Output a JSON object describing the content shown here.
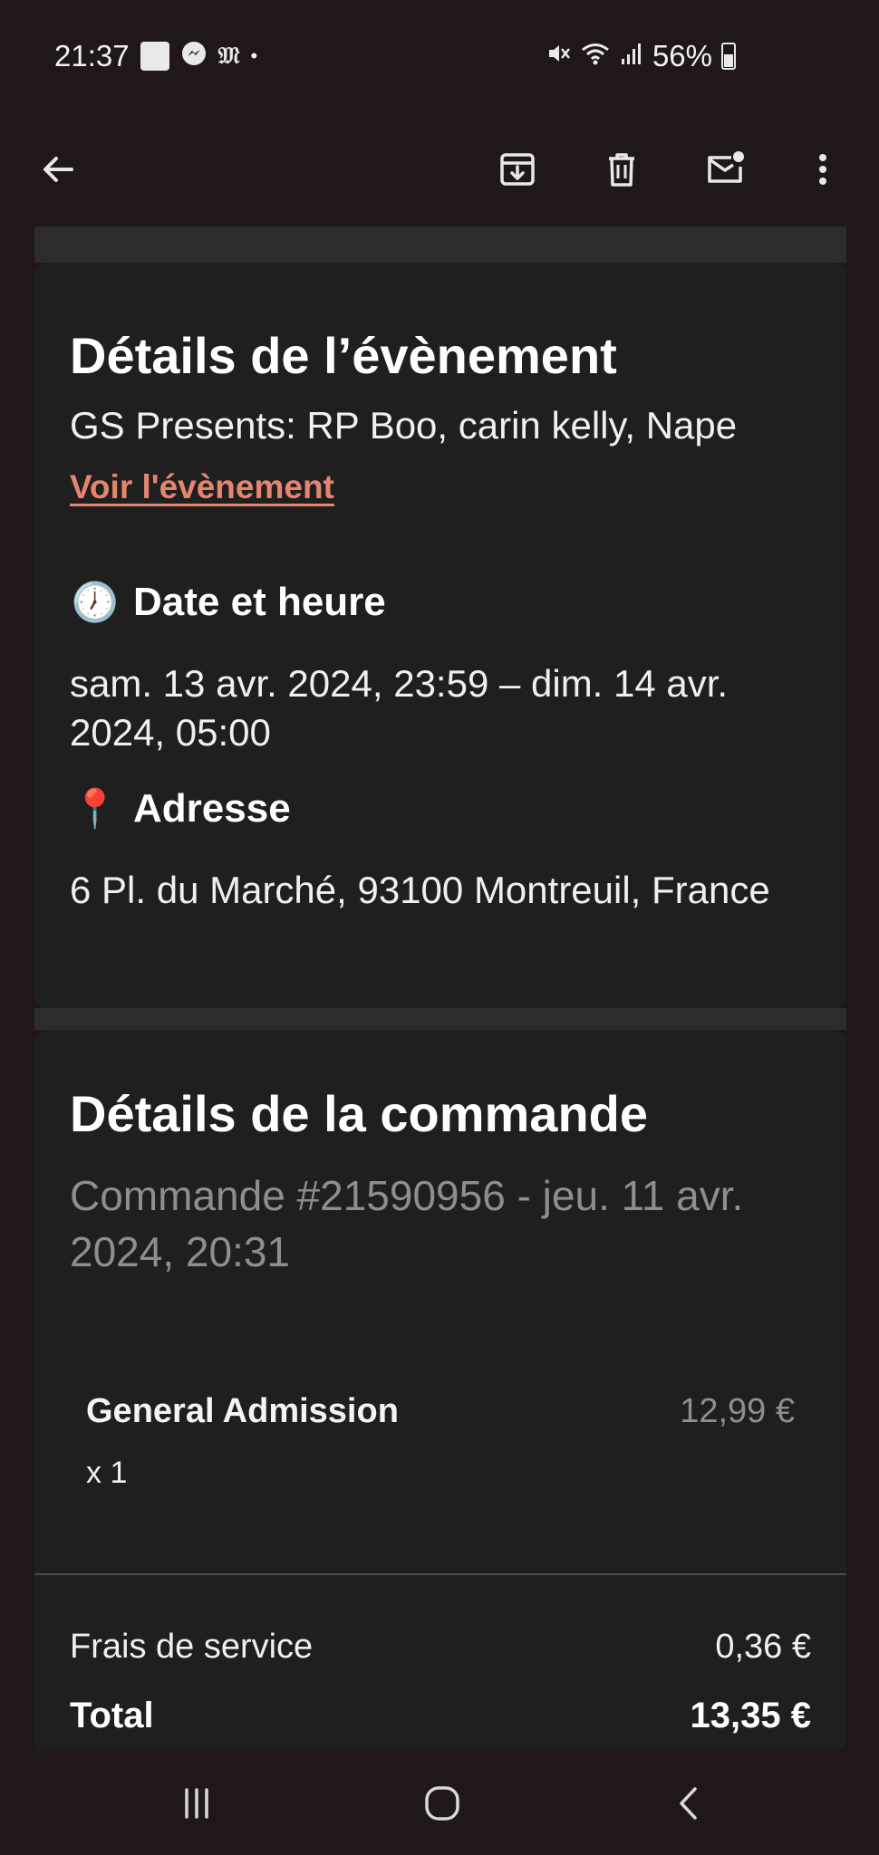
{
  "status_bar": {
    "time": "21:37",
    "notification_icons": [
      "screenshot-icon",
      "messenger-icon",
      "news-app-icon",
      "more-dot-icon"
    ],
    "battery": "56%",
    "icons": [
      "mute-icon",
      "wifi-icon",
      "signal-icon",
      "battery-icon"
    ]
  },
  "toolbar": {
    "back_icon": "arrow-left-icon",
    "actions": [
      "archive-icon",
      "delete-icon",
      "mark-unread-icon",
      "more-vertical-icon"
    ]
  },
  "event": {
    "title": "Détails de l’évènement",
    "name": "GS Presents: RP Boo, carin kelly, Nape",
    "link_label": "Voir l'évènement",
    "datetime_heading": "Date et heure",
    "datetime_emoji": "🕖",
    "datetime_line1": "sam. 13 avr. 2024, 23:59 – dim. 14 avr.",
    "datetime_line2": "2024, 05:00",
    "address_heading": "Adresse",
    "address_emoji": "📍",
    "address": "6 Pl. du Marché, 93100 Montreuil, France"
  },
  "order": {
    "title": "Détails de la commande",
    "meta_line1": "Commande #21590956 - jeu. 11 avr.",
    "meta_line2": "2024, 20:31",
    "items": [
      {
        "name": "General Admission",
        "price": "12,99 €",
        "qty": "x 1"
      }
    ],
    "fees_label": "Frais de service",
    "fees_value": "0,36 €",
    "total_label": "Total",
    "total_value": "13,35 €"
  },
  "nav_bar": {
    "buttons": [
      "recent-apps-icon",
      "home-icon",
      "back-icon"
    ]
  },
  "colors": {
    "background": "#201718",
    "card": "#1f1f1f",
    "link": "#e6846f",
    "muted": "#8e8e8e"
  }
}
